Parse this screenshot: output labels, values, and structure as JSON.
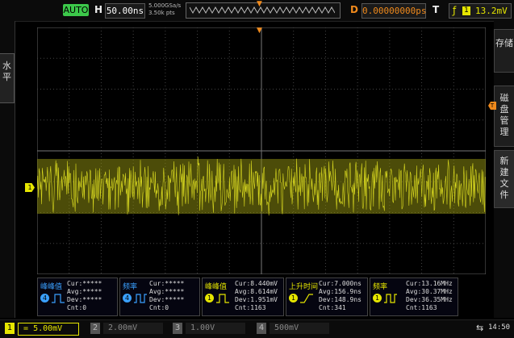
{
  "top": {
    "mode": "AUTO",
    "h_label": "H",
    "timebase": "50.00ns",
    "sample_rate": "5.000GSa/s",
    "mem_depth": "3.50k pts",
    "d_label": "D",
    "delay": "0.00000000ps",
    "t_label": "T",
    "trigger_source": "1",
    "trigger_level": "13.2mV"
  },
  "left_menu": {
    "label": "水平"
  },
  "right_menus": [
    "存储",
    "磁盘管理",
    "新建文件"
  ],
  "markers": {
    "ch1": "1",
    "trigger": "T"
  },
  "measurements": [
    {
      "title": "峰峰值",
      "channel": "4",
      "cur": "Cur:*****",
      "avg": "Avg:*****",
      "dev": "Dev:*****",
      "cnt": "Cnt:0",
      "color": "#3aa0ff"
    },
    {
      "title": "频率",
      "channel": "4",
      "cur": "Cur:*****",
      "avg": "Avg:*****",
      "dev": "Dev:*****",
      "cnt": "Cnt:0",
      "color": "#3aa0ff"
    },
    {
      "title": "峰峰值",
      "channel": "1",
      "cur": "Cur:8.440mV",
      "avg": "Avg:8.614mV",
      "dev": "Dev:1.951mV",
      "cnt": "Cnt:1163",
      "color": "#e6e600"
    },
    {
      "title": "上升时间",
      "channel": "1",
      "cur": "Cur:7.000ns",
      "avg": "Avg:156.9ns",
      "dev": "Dev:148.9ns",
      "cnt": "Cnt:341",
      "color": "#e6e600"
    },
    {
      "title": "频率",
      "channel": "1",
      "cur": "Cur:13.16MHz",
      "avg": "Avg:30.37MHz",
      "dev": "Dev:36.35MHz",
      "cnt": "Cnt:1163",
      "color": "#e6e600"
    }
  ],
  "channels": [
    {
      "num": "1",
      "coupling": "=",
      "scale": "5.00mV",
      "color": "#e6e600",
      "active": true
    },
    {
      "num": "2",
      "coupling": "",
      "scale": "2.00mV",
      "color": "#777777",
      "active": false
    },
    {
      "num": "3",
      "coupling": "",
      "scale": "1.00V",
      "color": "#777777",
      "active": false
    },
    {
      "num": "4",
      "coupling": "",
      "scale": "500mV",
      "color": "#777777",
      "active": false
    }
  ],
  "clock": "14:50",
  "colors": {
    "ch1": "#e6e600",
    "trigger": "#f08a1c",
    "ch4": "#3aa0ff",
    "auto": "#3cc84a"
  }
}
